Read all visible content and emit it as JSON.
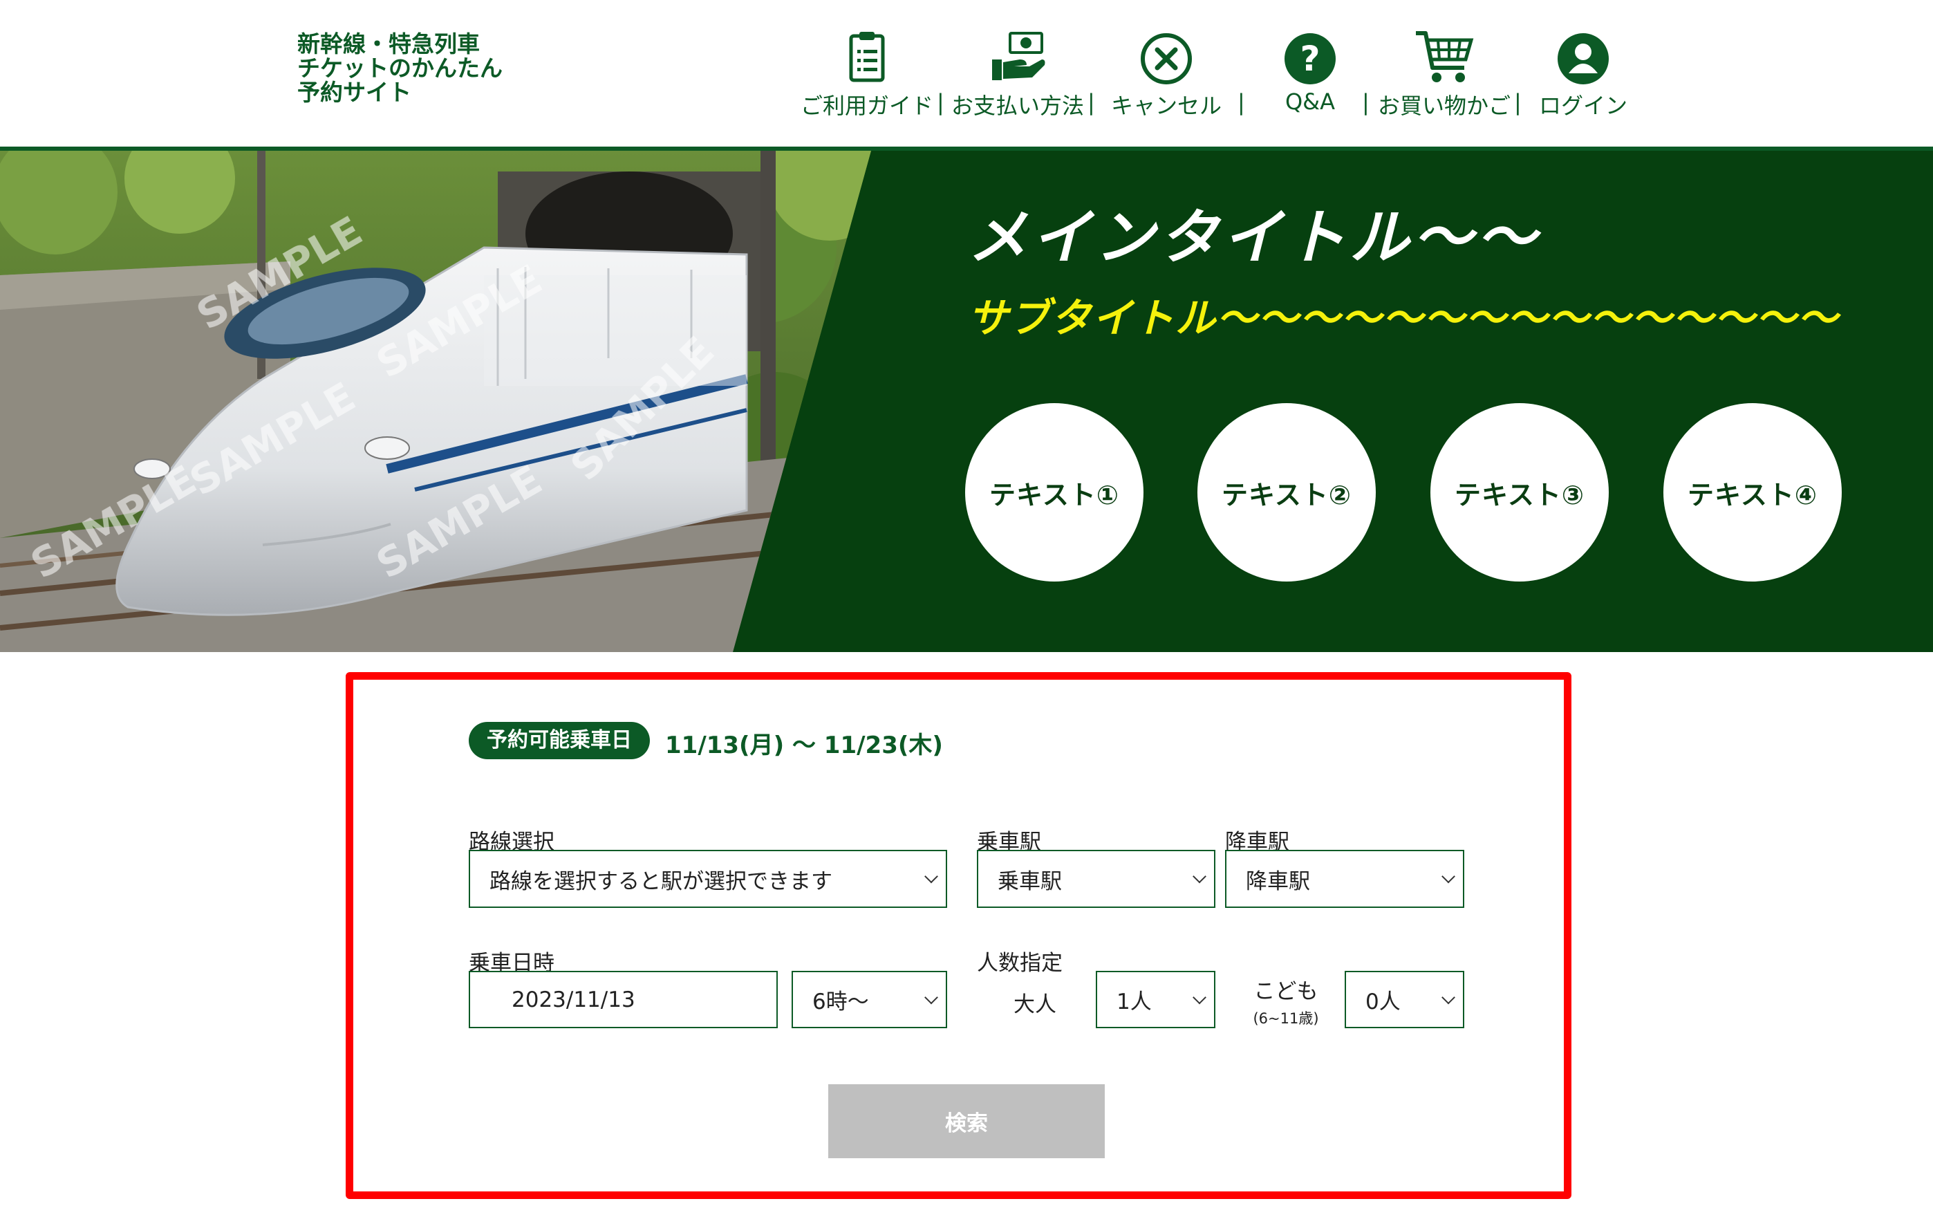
{
  "header": {
    "site_title": "新幹線・特急列車\nチケットのかんたん\n予約サイト",
    "nav": [
      {
        "label": "ご利用ガイド",
        "icon": "guide-clipboard-icon"
      },
      {
        "label": "お支払い方法",
        "icon": "payment-hand-icon"
      },
      {
        "label": "キャンセル",
        "icon": "cancel-circle-icon"
      },
      {
        "label": "Q&A",
        "icon": "question-icon"
      },
      {
        "label": "お買い物かご",
        "icon": "cart-icon"
      },
      {
        "label": "ログイン",
        "icon": "user-icon"
      }
    ],
    "separator": "|"
  },
  "hero": {
    "photo_watermark": "SAMPLE",
    "title": "メインタイトル〜〜",
    "subtitle": "サブタイトル〜〜〜〜〜〜〜〜〜〜〜〜〜〜〜",
    "circles": [
      "テキスト①",
      "テキスト②",
      "テキスト③",
      "テキスト④"
    ]
  },
  "search": {
    "date_badge": "予約可能乗車日",
    "date_range": "11/13(月) 〜 11/23(木)",
    "route": {
      "label": "路線選択",
      "value": "路線を選択すると駅が選択できます"
    },
    "departure": {
      "label": "乗車駅",
      "value": "乗車駅"
    },
    "arrival": {
      "label": "降車駅",
      "value": "降車駅"
    },
    "ride_date": {
      "label": "乗車日時",
      "value": "2023/11/13"
    },
    "ride_time": {
      "value": "6時〜"
    },
    "passengers": {
      "label": "人数指定",
      "adult_label": "大人",
      "adult_value": "1人",
      "child_label": "こども",
      "child_sub": "(6~11歳)",
      "child_value": "0人"
    },
    "button_label": "検索"
  },
  "colors": {
    "brand_green": "#0c5a26",
    "hero_bg": "#06400f",
    "subtitle_yellow": "#f5f20c",
    "highlight_red": "#ff0000",
    "button_gray": "#bfbfbf"
  }
}
